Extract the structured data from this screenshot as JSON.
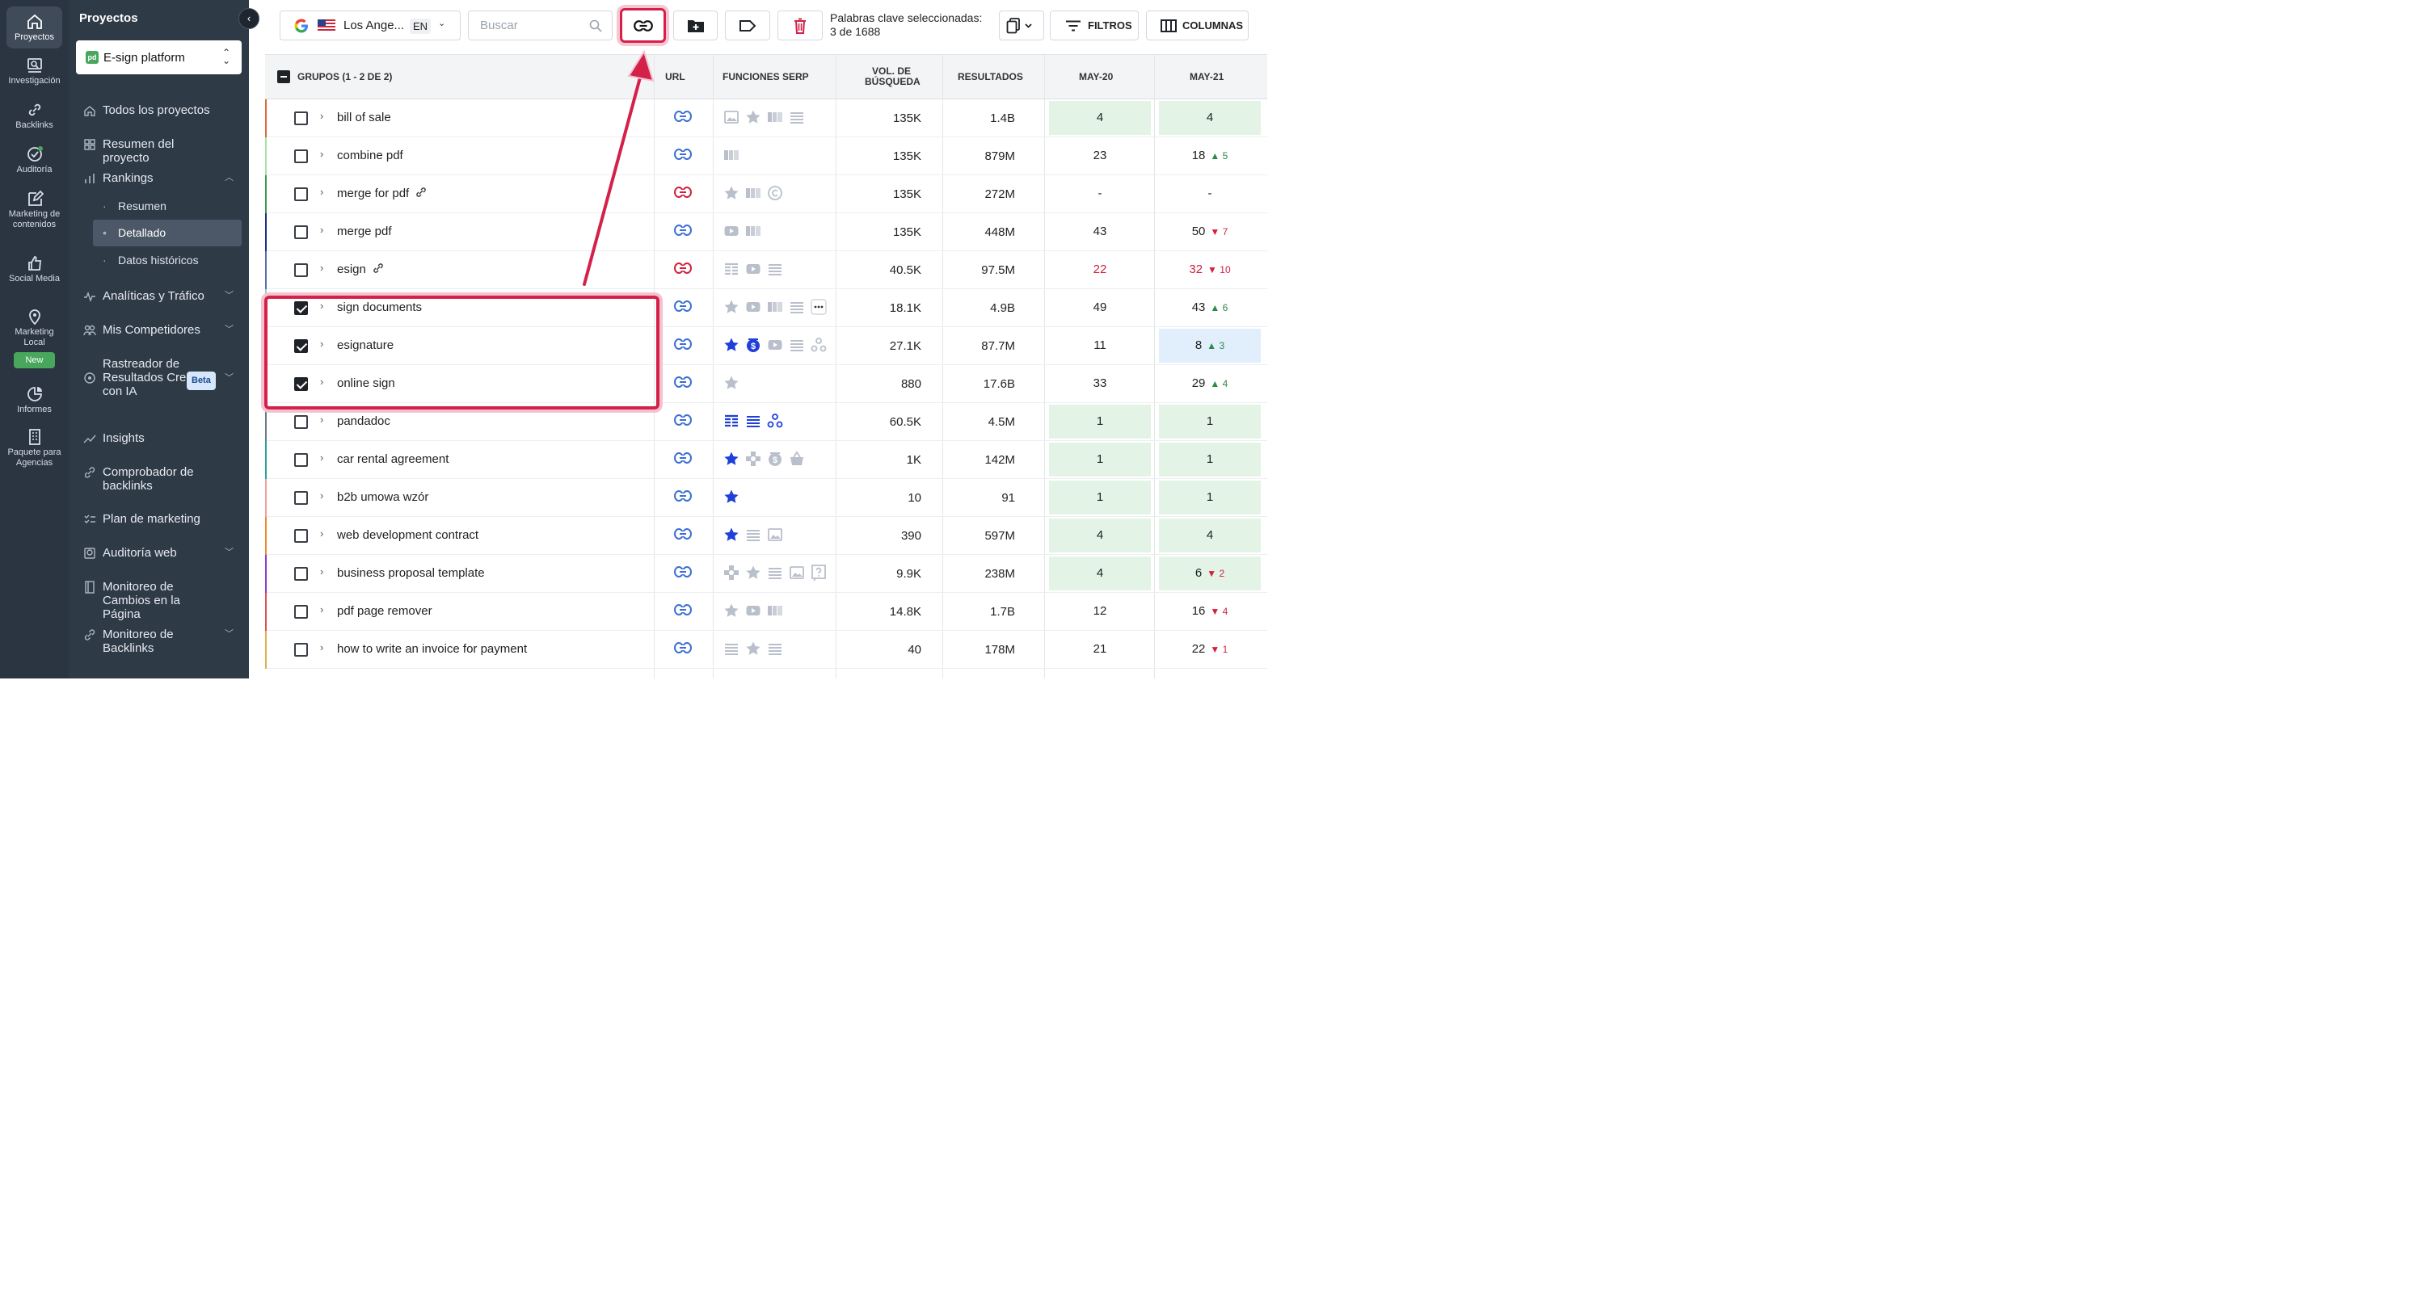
{
  "iconbar": {
    "items": [
      {
        "label": "Proyectos",
        "icon": "home-icon"
      },
      {
        "label": "Investigación",
        "icon": "research-icon"
      },
      {
        "label": "Backlinks",
        "icon": "backlinks-icon"
      },
      {
        "label": "Auditoría",
        "icon": "audit-icon"
      },
      {
        "label": "Marketing de contenidos",
        "icon": "content-icon"
      },
      {
        "label": "Social Media",
        "icon": "thumb-icon"
      },
      {
        "label": "Marketing Local",
        "icon": "pin-icon"
      },
      {
        "label": "Informes",
        "icon": "reports-icon"
      },
      {
        "label": "Paquete para Agencias",
        "icon": "building-icon"
      }
    ],
    "new_badge": "New"
  },
  "sidebar": {
    "title": "Proyectos",
    "project_name": "E-sign platform",
    "project_logo": "pd",
    "nav": [
      {
        "label": "Todos los proyectos"
      },
      {
        "label": "Resumen del proyecto"
      },
      {
        "label": "Rankings"
      },
      {
        "label": "Analíticas y Tráfico"
      },
      {
        "label": "Mis Competidores"
      },
      {
        "label": "Rastreador de Resultados Creados con IA"
      },
      {
        "label": "Insights"
      },
      {
        "label": "Comprobador de backlinks"
      },
      {
        "label": "Plan de marketing"
      },
      {
        "label": "Auditoría web"
      },
      {
        "label": "Monitoreo de Cambios en la Página"
      },
      {
        "label": "Monitoreo de Backlinks"
      }
    ],
    "rankings_sub": [
      {
        "label": "Resumen"
      },
      {
        "label": "Detallado"
      },
      {
        "label": "Datos históricos"
      }
    ],
    "beta_badge": "Beta"
  },
  "toolbar": {
    "location": "Los Ange...",
    "language": "EN",
    "search_placeholder": "Buscar",
    "selected_text_line1": "Palabras clave seleccionadas:",
    "selected_text_line2": "3 de 1688",
    "filters_label": "FILTROS",
    "columns_label": "COLUMNAS"
  },
  "table": {
    "headers": {
      "groups": "GRUPOS (1 - 2 DE 2)",
      "url": "URL",
      "serp": "FUNCIONES SERP",
      "volume_line1": "VOL. DE",
      "volume_line2": "BÚSQUEDA",
      "results": "RESULTADOS",
      "may20": "MAY-20",
      "may21": "MAY-21"
    },
    "rows": [
      {
        "kw": "bill of sale",
        "color": "#e0653a",
        "checked": false,
        "kwlink": false,
        "urlstate": "blue",
        "serp": [
          "image",
          "star",
          "carousel",
          "list"
        ],
        "volume": "135K",
        "results": "1.4B",
        "may20": "4",
        "may20style": "good",
        "may21": "4",
        "may21style": "good",
        "delta": "",
        "dir": ""
      },
      {
        "kw": "combine pdf",
        "color": "#a8e0a6",
        "checked": false,
        "kwlink": false,
        "urlstate": "blue",
        "serp": [
          "carousel"
        ],
        "volume": "135K",
        "results": "879M",
        "may20": "23",
        "may20style": "",
        "may21": "18",
        "may21style": "",
        "delta": "5",
        "dir": "up"
      },
      {
        "kw": "merge for pdf",
        "color": "#3a9a4e",
        "checked": false,
        "kwlink": true,
        "urlstate": "red",
        "serp": [
          "star",
          "carousel",
          "copyright"
        ],
        "volume": "135K",
        "results": "272M",
        "may20": "-",
        "may20style": "",
        "may21": "-",
        "may21style": "",
        "delta": "",
        "dir": ""
      },
      {
        "kw": "merge pdf",
        "color": "#1f2a8a",
        "checked": false,
        "kwlink": false,
        "urlstate": "blue",
        "serp": [
          "video",
          "carousel"
        ],
        "volume": "135K",
        "results": "448M",
        "may20": "43",
        "may20style": "",
        "may21": "50",
        "may21style": "",
        "delta": "7",
        "dir": "down"
      },
      {
        "kw": "esign",
        "color": "#5a6fa8",
        "checked": false,
        "kwlink": true,
        "urlstate": "red",
        "serp": [
          "table",
          "video",
          "list"
        ],
        "volume": "40.5K",
        "results": "97.5M",
        "may20": "22",
        "may20style": "red",
        "may21": "32",
        "may21style": "red",
        "delta": "10",
        "dir": "down"
      },
      {
        "kw": "sign documents",
        "color": "#9ec9c9",
        "checked": true,
        "kwlink": false,
        "urlstate": "blue",
        "serp": [
          "star",
          "video",
          "carousel",
          "list",
          "more"
        ],
        "volume": "18.1K",
        "results": "4.9B",
        "may20": "49",
        "may20style": "",
        "may21": "43",
        "may21style": "",
        "delta": "6",
        "dir": "up"
      },
      {
        "kw": "esignature",
        "color": "#e0b050",
        "checked": true,
        "kwlink": false,
        "urlstate": "blue",
        "serp": [
          "star-blue",
          "dollar-blue",
          "video",
          "list",
          "related"
        ],
        "volume": "27.1K",
        "results": "87.7M",
        "may20": "11",
        "may20style": "",
        "may21": "8",
        "may21style": "blue",
        "delta": "3",
        "dir": "up"
      },
      {
        "kw": "online sign",
        "color": "#3a9a4e",
        "checked": true,
        "kwlink": false,
        "urlstate": "blue",
        "serp": [
          "star"
        ],
        "volume": "880",
        "results": "17.6B",
        "may20": "33",
        "may20style": "",
        "may21": "29",
        "may21style": "",
        "delta": "4",
        "dir": "up"
      },
      {
        "kw": "pandadoc",
        "color": "#6a7a8a",
        "checked": false,
        "kwlink": false,
        "urlstate": "blue",
        "serp": [
          "table-blue",
          "list-blue",
          "related-blue"
        ],
        "volume": "60.5K",
        "results": "4.5M",
        "may20": "1",
        "may20style": "good",
        "may21": "1",
        "may21style": "good",
        "delta": "",
        "dir": ""
      },
      {
        "kw": "car rental agreement",
        "color": "#2aa0a0",
        "checked": false,
        "kwlink": false,
        "urlstate": "blue",
        "serp": [
          "star-blue",
          "plus",
          "dollar",
          "basket"
        ],
        "volume": "1K",
        "results": "142M",
        "may20": "1",
        "may20style": "good",
        "may21": "1",
        "may21style": "good",
        "delta": "",
        "dir": ""
      },
      {
        "kw": "b2b umowa wzór",
        "color": "#f0a0a0",
        "checked": false,
        "kwlink": false,
        "urlstate": "blue",
        "serp": [
          "star-blue"
        ],
        "volume": "10",
        "results": "91",
        "may20": "1",
        "may20style": "good",
        "may21": "1",
        "may21style": "good",
        "delta": "",
        "dir": ""
      },
      {
        "kw": "web development contract",
        "color": "#f08a2a",
        "checked": false,
        "kwlink": false,
        "urlstate": "blue",
        "serp": [
          "star-blue",
          "list",
          "image"
        ],
        "volume": "390",
        "results": "597M",
        "may20": "4",
        "may20style": "good",
        "may21": "4",
        "may21style": "good",
        "delta": "",
        "dir": ""
      },
      {
        "kw": "business proposal template",
        "color": "#8a3ac8",
        "checked": false,
        "kwlink": false,
        "urlstate": "blue",
        "serp": [
          "plus",
          "star",
          "list",
          "image",
          "question"
        ],
        "volume": "9.9K",
        "results": "238M",
        "may20": "4",
        "may20style": "good",
        "may21": "6",
        "may21style": "good",
        "delta": "2",
        "dir": "down"
      },
      {
        "kw": "pdf page remover",
        "color": "#e05050",
        "checked": false,
        "kwlink": false,
        "urlstate": "blue",
        "serp": [
          "star",
          "video",
          "carousel"
        ],
        "volume": "14.8K",
        "results": "1.7B",
        "may20": "12",
        "may20style": "",
        "may21": "16",
        "may21style": "",
        "delta": "4",
        "dir": "down"
      },
      {
        "kw": "how to write an invoice for payment",
        "color": "#e0b050",
        "checked": false,
        "kwlink": false,
        "urlstate": "blue",
        "serp": [
          "list",
          "star",
          "list"
        ],
        "volume": "40",
        "results": "178M",
        "may20": "21",
        "may20style": "",
        "may21": "22",
        "may21style": "",
        "delta": "1",
        "dir": "down"
      }
    ]
  },
  "colors": {
    "accent_red": "#d3214a",
    "sidebar_bg": "#2f3a47",
    "iconbar_bg": "#2b3542",
    "good_rank_bg": "#e3f3e6",
    "up": "#2a8a48",
    "down": "#d0213d",
    "link_blue": "#3b6fd4"
  }
}
